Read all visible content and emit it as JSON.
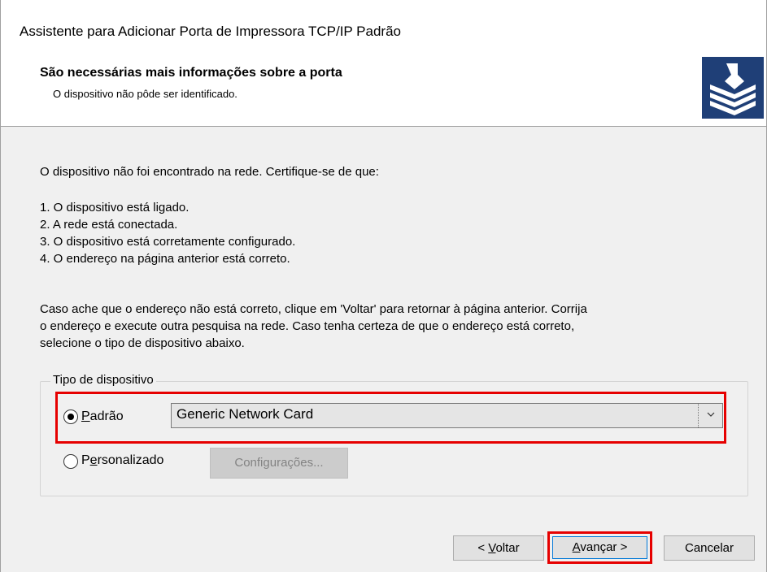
{
  "window": {
    "title": "Assistente para Adicionar Porta de Impressora TCP/IP Padrão"
  },
  "header": {
    "title": "São necessárias mais informações sobre a porta",
    "subtitle": "O dispositivo não pôde ser identificado.",
    "icon": "printer-icon"
  },
  "body": {
    "intro": "O dispositivo não foi encontrado na rede.  Certifique-se de que:",
    "checklist": [
      "1. O dispositivo está ligado.",
      "2. A rede está conectada.",
      "3. O dispositivo está corretamente configurado.",
      "4. O endereço na página anterior está correto."
    ],
    "paragraph_lines": [
      "Caso ache que o endereço não está correto, clique em 'Voltar' para retornar à página anterior. Corrija",
      "o endereço e execute outra pesquisa na rede. Caso tenha certeza de que o endereço está correto,",
      "selecione o tipo de dispositivo abaixo."
    ]
  },
  "device_type": {
    "group_label": "Tipo de dispositivo",
    "standard": {
      "label": "Padrão",
      "mnemonic": "P",
      "rest": "adrão",
      "selected": true
    },
    "custom": {
      "label": "Personalizado",
      "mnemonic": "e",
      "pre": "P",
      "rest": "rsonalizado",
      "selected": false
    },
    "combo_value": "Generic Network Card",
    "settings_button": "Configurações..."
  },
  "footer": {
    "back_label": "< Voltar",
    "back_pre": "< ",
    "back_mnemonic": "V",
    "back_rest": "oltar",
    "next_label": "Avançar >",
    "next_mnemonic": "A",
    "next_rest": "vançar >",
    "cancel_label": "Cancelar"
  },
  "colors": {
    "highlight": "#e60000",
    "icon_bg": "#1f3f77",
    "window_bg": "#f0f0f0"
  }
}
